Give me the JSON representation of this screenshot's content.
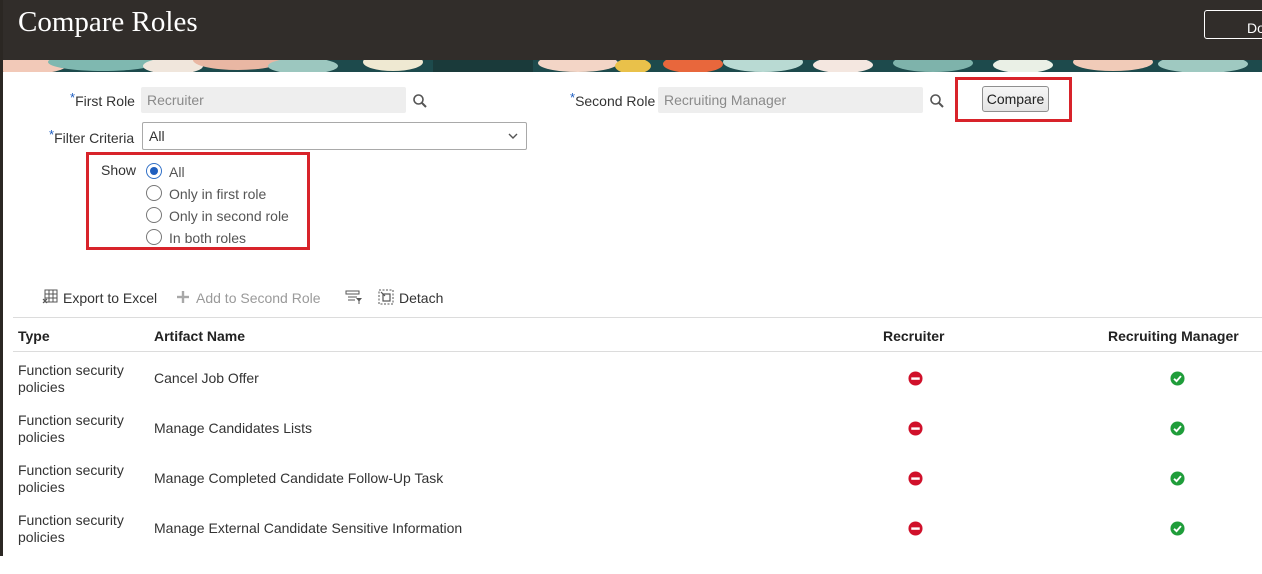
{
  "header": {
    "title": "Compare Roles",
    "done_label": "Done"
  },
  "form": {
    "first_role": {
      "label": "First Role",
      "value": "Recruiter",
      "required_mark": "*"
    },
    "second_role": {
      "label": "Second Role",
      "value": "Recruiting Manager",
      "required_mark": "*"
    },
    "compare_label": "Compare",
    "filter_criteria": {
      "label": "Filter Criteria",
      "value": "All",
      "required_mark": "*"
    },
    "show": {
      "label": "Show",
      "options": [
        "All",
        "Only in first role",
        "Only in second role",
        "In both roles"
      ],
      "selected": "All"
    }
  },
  "toolbar": {
    "export_label": "Export to Excel",
    "add_label": "Add to Second Role",
    "detach_label": "Detach",
    "icons": [
      "excel-export-icon",
      "plus-icon",
      "filter-icon",
      "detach-icon"
    ]
  },
  "table": {
    "columns": [
      "Type",
      "Artifact Name",
      "Recruiter",
      "Recruiting Manager"
    ],
    "rows": [
      {
        "type_line1": "Function security",
        "type_line2": "policies",
        "name": "Cancel Job Offer",
        "recruiter": "absent",
        "recruiting_manager": "present"
      },
      {
        "type_line1": "Function security",
        "type_line2": "policies",
        "name": "Manage Candidates Lists",
        "recruiter": "absent",
        "recruiting_manager": "present"
      },
      {
        "type_line1": "Function security",
        "type_line2": "policies",
        "name": "Manage Completed Candidate Follow-Up Task",
        "recruiter": "absent",
        "recruiting_manager": "present"
      },
      {
        "type_line1": "Function security",
        "type_line2": "policies",
        "name": "Manage External Candidate Sensitive Information",
        "recruiter": "absent",
        "recruiting_manager": "present"
      }
    ]
  },
  "colors": {
    "header_bg": "#312d2a",
    "highlight": "#d8232a",
    "absent": "#d0102a",
    "present": "#1f9d3a",
    "accent": "#1f5fbf"
  }
}
